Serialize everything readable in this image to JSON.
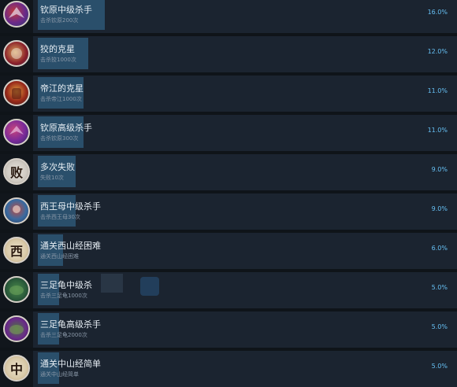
{
  "achievements": [
    {
      "title": "钦原中级杀手",
      "desc": "击杀钦原200次",
      "percent": "16.0%",
      "percent_value": 16.0,
      "icon": "qinyuan-bird-icon",
      "colors": [
        "#6a2a8a",
        "#c23a3a"
      ]
    },
    {
      "title": "狡的克星",
      "desc": "击杀狡1000次",
      "percent": "12.0%",
      "percent_value": 12.0,
      "icon": "jiao-beast-icon",
      "colors": [
        "#8a1f2a",
        "#d9a35a"
      ]
    },
    {
      "title": "帝江的克星",
      "desc": "击杀帝江1000次",
      "percent": "11.0%",
      "percent_value": 11.0,
      "icon": "dijiang-icon",
      "colors": [
        "#9a2a1a",
        "#e0a040"
      ]
    },
    {
      "title": "钦原高级杀手",
      "desc": "击杀钦原300次",
      "percent": "11.0%",
      "percent_value": 11.0,
      "icon": "qinyuan-bird-icon",
      "colors": [
        "#7a2a9a",
        "#c8447a"
      ]
    },
    {
      "title": "多次失败",
      "desc": "失败10次",
      "percent": "9.0%",
      "percent_value": 9.0,
      "icon": "defeat-glyph-icon",
      "glyph": "败",
      "colors": [
        "#cfcac2",
        "#9a958c"
      ]
    },
    {
      "title": "西王母中级杀手",
      "desc": "击杀西王母30次",
      "percent": "9.0%",
      "percent_value": 9.0,
      "icon": "xiwangmu-icon",
      "colors": [
        "#3a6aa0",
        "#c04a40"
      ]
    },
    {
      "title": "通关西山经困难",
      "desc": "通关西山经困难",
      "percent": "6.0%",
      "percent_value": 6.0,
      "icon": "west-glyph-icon",
      "glyph": "西",
      "colors": [
        "#d8c9a8",
        "#b89a6a"
      ]
    },
    {
      "title": "三足龟中级杀",
      "desc": "击杀三足龟1000次",
      "percent": "5.0%",
      "percent_value": 5.0,
      "icon": "three-legged-turtle-icon",
      "colors": [
        "#2a5a3a",
        "#4a8a4a"
      ]
    },
    {
      "title": "三足龟高级杀手",
      "desc": "击杀三足龟2000次",
      "percent": "5.0%",
      "percent_value": 5.0,
      "icon": "three-legged-turtle-icon",
      "colors": [
        "#6a2a8a",
        "#4a7a3a"
      ]
    },
    {
      "title": "通关中山经简单",
      "desc": "通关中山经简单",
      "percent": "5.0%",
      "percent_value": 5.0,
      "icon": "middle-glyph-icon",
      "glyph": "中",
      "colors": [
        "#d8c9a8",
        "#c0a070"
      ]
    }
  ]
}
